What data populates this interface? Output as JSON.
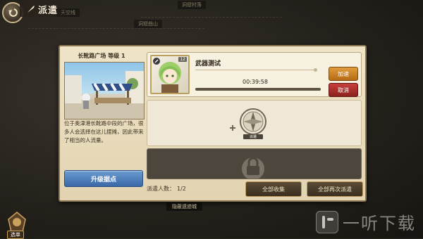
{
  "header": {
    "title": "派遣"
  },
  "map": {
    "top_labels": [
      "天空线",
      "洞窟村落",
      "洞窟曲山"
    ],
    "bottom_label": "隐蔽遗迹城"
  },
  "site": {
    "title": "长靴路广场 等级 1",
    "description": "位于奥津港长靴路中段的广场，很多人会选择在这儿摆摊，因此带来了相当的人流量。",
    "upgrade_label": "升级据点"
  },
  "dispatch": {
    "count_label": "派遣人数：",
    "count_value": "1/2"
  },
  "active_mission": {
    "name": "武器测试",
    "timer": "00:39:58",
    "progress": 0,
    "speed_label": "加速",
    "cancel_label": "取消",
    "character_level": "12"
  },
  "empty_slot": {
    "stamp_text": "派遣"
  },
  "buttons": {
    "collect_all": "全部收集",
    "redispatch_all": "全部再次派遣"
  },
  "menu": {
    "label": "选单"
  },
  "watermark": {
    "text": "一听下载"
  },
  "colors": {
    "panel_bg": "#e9dcbe",
    "speed_button": "#d08a2b",
    "cancel_button": "#b3322d",
    "upgrade_button": "#4b7bbd"
  }
}
